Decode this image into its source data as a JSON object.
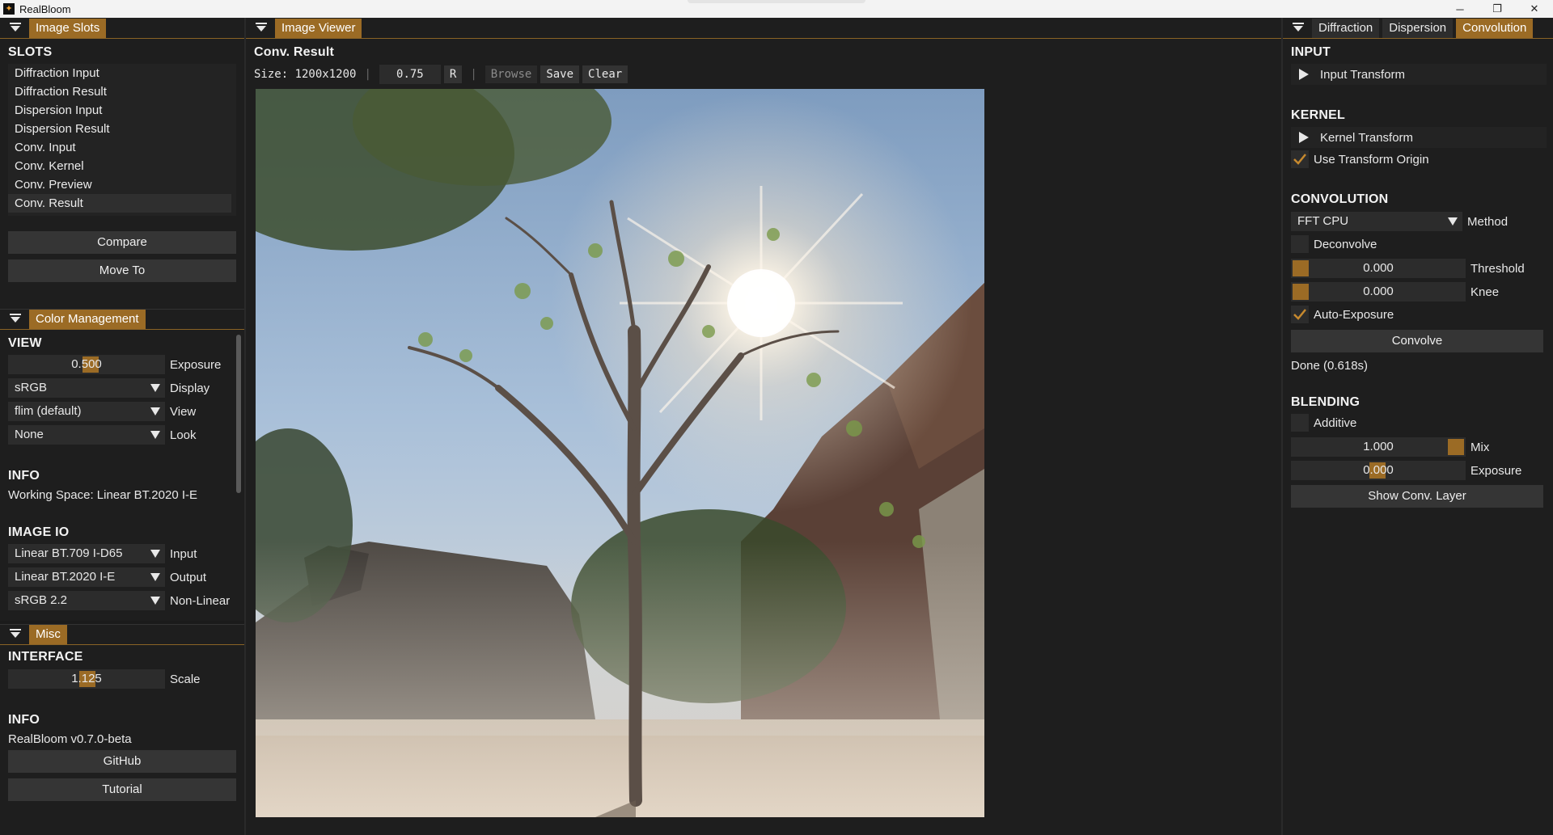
{
  "window": {
    "title": "RealBloom",
    "minimize": "─",
    "maximize": "❐",
    "close": "✕"
  },
  "image_slots_panel": {
    "tab": "Image Slots",
    "section_title": "SLOTS",
    "slots": [
      "Diffraction Input",
      "Diffraction Result",
      "Dispersion Input",
      "Dispersion Result",
      "Conv. Input",
      "Conv. Kernel",
      "Conv. Preview",
      "Conv. Result"
    ],
    "selected_slot": "Conv. Result",
    "compare_label": "Compare",
    "move_to_label": "Move To"
  },
  "color_management_panel": {
    "tab": "Color Management",
    "view_title": "VIEW",
    "exposure_value": "0.500",
    "exposure_label": "Exposure",
    "display_value": "sRGB",
    "display_label": "Display",
    "view_value": "flim (default)",
    "view_label": "View",
    "look_value": "None",
    "look_label": "Look",
    "info_title": "INFO",
    "working_space": "Working Space: Linear BT.2020 I-E",
    "image_io_title": "IMAGE IO",
    "input_value": "Linear BT.709 I-D65",
    "input_label": "Input",
    "output_value": "Linear BT.2020 I-E",
    "output_label": "Output",
    "nonlinear_value": "sRGB 2.2",
    "nonlinear_label": "Non-Linear"
  },
  "misc_panel": {
    "tab": "Misc",
    "interface_title": "INTERFACE",
    "scale_value": "1.125",
    "scale_label": "Scale",
    "info_title": "INFO",
    "version": "RealBloom v0.7.0-beta",
    "github_label": "GitHub",
    "tutorial_label": "Tutorial"
  },
  "image_viewer": {
    "tab": "Image Viewer",
    "image_title": "Conv. Result",
    "size_text": "Size: 1200x1200",
    "zoom_value": "0.75",
    "reset_label": "R",
    "browse_label": "Browse",
    "save_label": "Save",
    "clear_label": "Clear"
  },
  "right_panel": {
    "tabs": [
      "Diffraction",
      "Dispersion",
      "Convolution"
    ],
    "active_tab": "Convolution",
    "input_title": "INPUT",
    "input_transform_label": "Input Transform",
    "kernel_title": "KERNEL",
    "kernel_transform_label": "Kernel Transform",
    "use_transform_origin_label": "Use Transform Origin",
    "use_transform_origin_checked": true,
    "convolution_title": "CONVOLUTION",
    "method_value": "FFT CPU",
    "method_label": "Method",
    "deconvolve_label": "Deconvolve",
    "deconvolve_checked": false,
    "threshold_value": "0.000",
    "threshold_label": "Threshold",
    "knee_value": "0.000",
    "knee_label": "Knee",
    "auto_exposure_label": "Auto-Exposure",
    "auto_exposure_checked": true,
    "convolve_label": "Convolve",
    "status_text": "Done (0.618s)",
    "blending_title": "BLENDING",
    "additive_label": "Additive",
    "additive_checked": false,
    "mix_value": "1.000",
    "mix_label": "Mix",
    "blend_exposure_value": "0.000",
    "blend_exposure_label": "Exposure",
    "show_conv_layer_label": "Show Conv. Layer"
  },
  "colors": {
    "accent": "#9b6b25",
    "panel_bg": "#1e1e1e",
    "widget_bg": "#2c2c2c"
  }
}
